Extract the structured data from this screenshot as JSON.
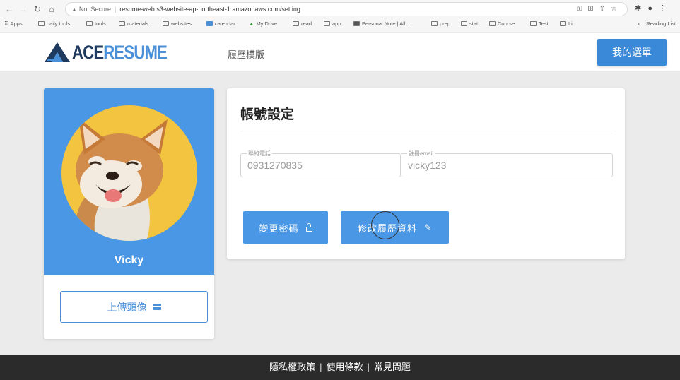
{
  "browser": {
    "security_label": "Not Secure",
    "url": "resume-web.s3-website-ap-northeast-1.amazonaws.com/setting",
    "bookmarks": [
      "Apps",
      "daily tools",
      "tools",
      "materials",
      "websites",
      "calendar",
      "My Drive",
      "read",
      "app",
      "Personal Note | All...",
      "prep",
      "stat",
      "Course",
      "Test",
      "Li"
    ],
    "reading_list": "Reading List"
  },
  "header": {
    "logo_ace": "ACE",
    "logo_resume": "RESUME",
    "nav_templates": "履歷模版",
    "menu_button": "我的選單"
  },
  "profile": {
    "username": "Vicky",
    "upload_button": "上傳頭像"
  },
  "settings": {
    "title": "帳號設定",
    "phone_label": "聯絡電話",
    "phone_value": "0931270835",
    "email_label": "註冊email",
    "email_value": "vicky123",
    "change_password_button": "變更密碼",
    "edit_resume_button": "修改履歷資料"
  },
  "footer": {
    "privacy": "隱私權政策",
    "terms": "使用條款",
    "faq": "常見問題"
  },
  "colors": {
    "primary": "#4a97e6",
    "brand_dark": "#1f3a5f",
    "footer_bg": "#2b2b2b",
    "avatar_bg": "#f3c440"
  }
}
